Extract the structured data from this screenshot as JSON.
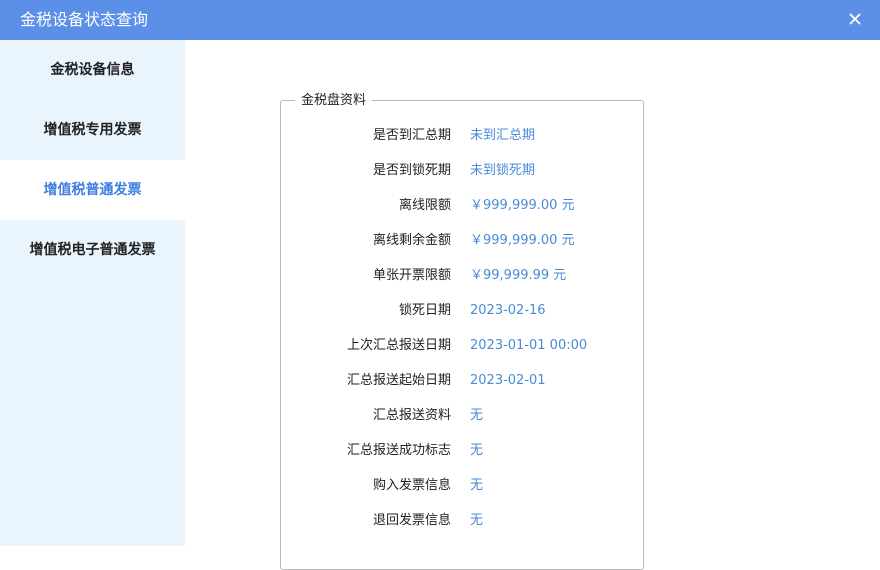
{
  "window": {
    "title": "金税设备状态查询"
  },
  "sidebar": {
    "items": [
      {
        "label": "金税设备信息"
      },
      {
        "label": "增值税专用发票"
      },
      {
        "label": "增值税普通发票"
      },
      {
        "label": "增值税电子普通发票"
      }
    ],
    "active_item": "增值税普通发票"
  },
  "panel": {
    "legend": "金税盘资料",
    "rows": [
      {
        "label": "是否到汇总期",
        "value": "未到汇总期"
      },
      {
        "label": "是否到锁死期",
        "value": "未到锁死期"
      },
      {
        "label": "离线限额",
        "value": "￥999,999.00 元"
      },
      {
        "label": "离线剩余金额",
        "value": "￥999,999.00 元"
      },
      {
        "label": "单张开票限额",
        "value": "￥99,999.99 元"
      },
      {
        "label": "锁死日期",
        "value": "2023-02-16"
      },
      {
        "label": "上次汇总报送日期",
        "value": "2023-01-01 00:00"
      },
      {
        "label": "汇总报送起始日期",
        "value": "2023-02-01"
      },
      {
        "label": "汇总报送资料",
        "value": "无"
      },
      {
        "label": "汇总报送成功标志",
        "value": "无"
      },
      {
        "label": "购入发票信息",
        "value": "无"
      },
      {
        "label": "退回发票信息",
        "value": "无"
      }
    ]
  },
  "colors": {
    "titlebar": "#5b8fe8",
    "sidebar": "#eaf4fd",
    "accent": "#3f7fe0",
    "value_text": "#4a8ad8"
  },
  "icons": {
    "close": "close-icon"
  }
}
